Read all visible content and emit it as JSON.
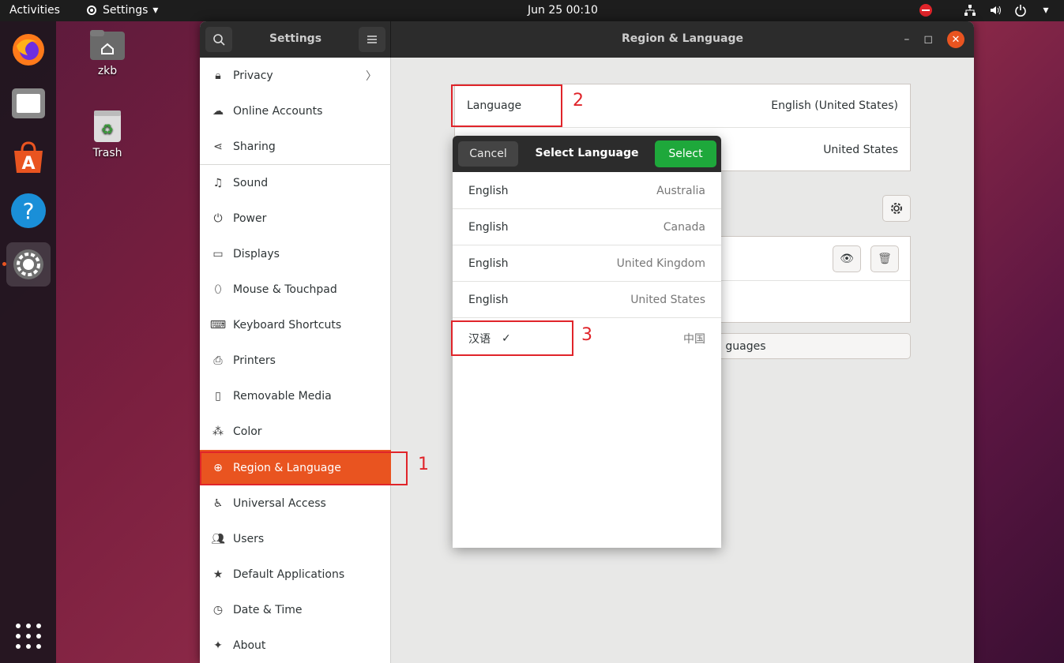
{
  "topbar": {
    "activities": "Activities",
    "app_menu": "Settings",
    "clock": "Jun 25  00:10"
  },
  "desktop": {
    "home_label": "zkb",
    "trash_label": "Trash"
  },
  "window": {
    "settings_title": "Settings",
    "page_title": "Region & Language"
  },
  "sidebar": {
    "items": [
      {
        "label": "Privacy"
      },
      {
        "label": "Online Accounts"
      },
      {
        "label": "Sharing"
      },
      {
        "label": "Sound"
      },
      {
        "label": "Power"
      },
      {
        "label": "Displays"
      },
      {
        "label": "Mouse & Touchpad"
      },
      {
        "label": "Keyboard Shortcuts"
      },
      {
        "label": "Printers"
      },
      {
        "label": "Removable Media"
      },
      {
        "label": "Color"
      },
      {
        "label": "Region & Language"
      },
      {
        "label": "Universal Access"
      },
      {
        "label": "Users"
      },
      {
        "label": "Default Applications"
      },
      {
        "label": "Date & Time"
      },
      {
        "label": "About"
      }
    ]
  },
  "content": {
    "language_label": "Language",
    "language_value": "English (United States)",
    "formats_value": "United States",
    "manage_partial": "guages"
  },
  "dialog": {
    "cancel": "Cancel",
    "title": "Select Language",
    "select": "Select",
    "languages": [
      {
        "name": "English",
        "country": "Australia"
      },
      {
        "name": "English",
        "country": "Canada"
      },
      {
        "name": "English",
        "country": "United Kingdom"
      },
      {
        "name": "English",
        "country": "United States"
      },
      {
        "name": "汉语",
        "country": "中国",
        "checked": true
      }
    ]
  },
  "annotations": {
    "one": "1",
    "two": "2",
    "three": "3"
  },
  "colors": {
    "accent": "#e95420",
    "select_green": "#1ea83b",
    "annotation_red": "#e0242a"
  }
}
